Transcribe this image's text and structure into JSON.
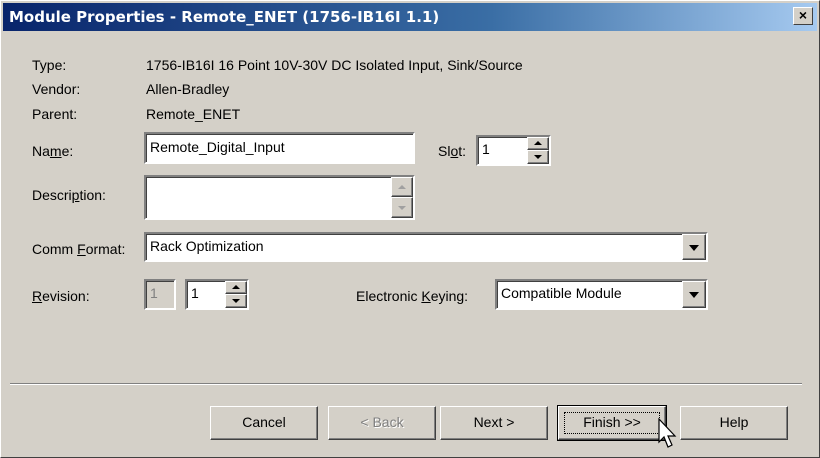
{
  "window": {
    "title": "Module Properties - Remote_ENET (1756-IB16I 1.1)",
    "close_glyph": "×"
  },
  "info": [
    {
      "label": "Type:",
      "value": "1756-IB16I 16 Point 10V-30V DC Isolated Input, Sink/Source"
    },
    {
      "label": "Vendor:",
      "value": "Allen-Bradley"
    },
    {
      "label": "Parent:",
      "value": "Remote_ENET"
    }
  ],
  "name": {
    "label_pre": "Na",
    "label_key": "m",
    "label_post": "e:",
    "value": "Remote_Digital_Input"
  },
  "slot": {
    "label_pre": "Sl",
    "label_key": "o",
    "label_post": "t:",
    "value": "1"
  },
  "description": {
    "label_pre": "Descri",
    "label_key": "p",
    "label_post": "tion:",
    "value": ""
  },
  "comm_format": {
    "label_pre": "Comm ",
    "label_key": "F",
    "label_post": "ormat:",
    "value": "Rack Optimization"
  },
  "revision": {
    "label_pre": "",
    "label_key": "R",
    "label_post": "evision:",
    "major": "1",
    "minor": "1"
  },
  "keying": {
    "label_pre": "Electronic ",
    "label_key": "K",
    "label_post": "eying:",
    "value": "Compatible Module"
  },
  "buttons": {
    "cancel": "Cancel",
    "back": "< Back",
    "next": "Next >",
    "finish": "Finish >>",
    "help": "Help"
  }
}
